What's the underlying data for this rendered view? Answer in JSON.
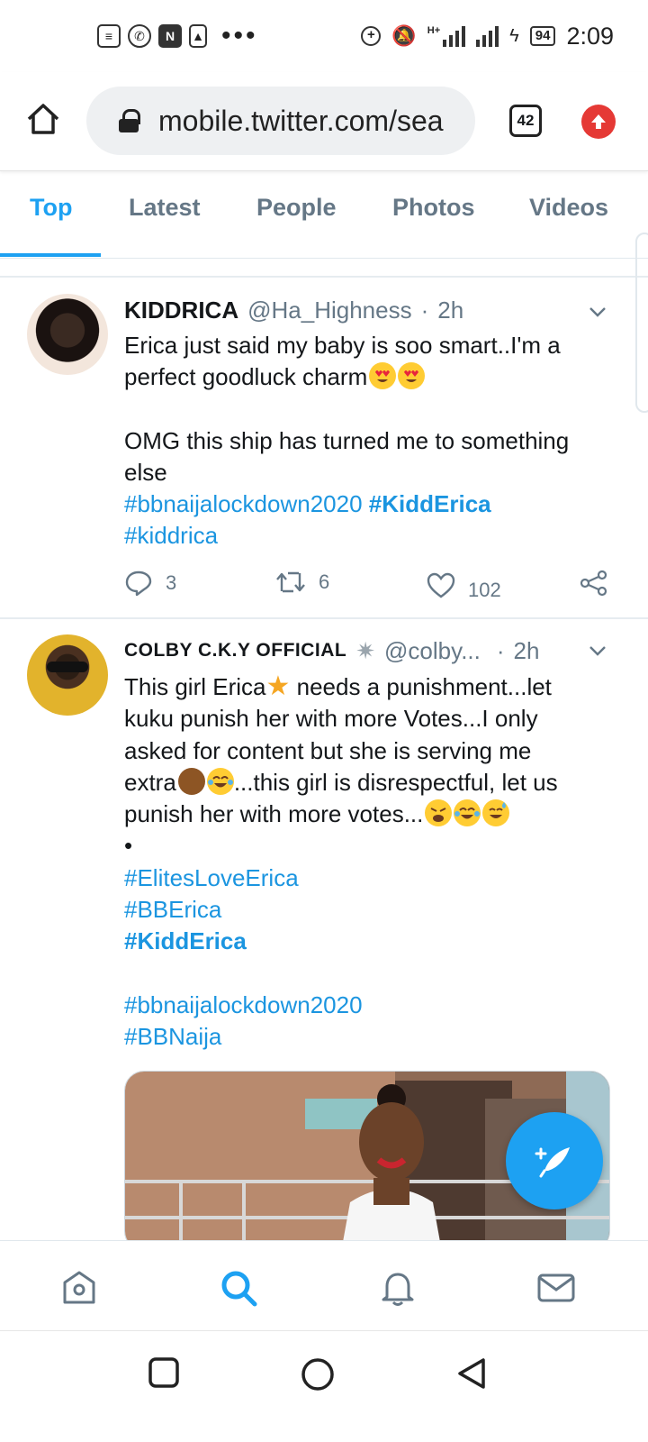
{
  "status_bar": {
    "left_icons": [
      "notes-icon",
      "whatsapp-icon",
      "n-app-icon",
      "alert-icon"
    ],
    "more": "•••",
    "battery": "94",
    "time": "2:09",
    "net_label": "H+"
  },
  "browser": {
    "url": "mobile.twitter.com/sea",
    "tab_count": "42"
  },
  "search_tabs": [
    {
      "label": "Top",
      "active": true
    },
    {
      "label": "Latest",
      "active": false
    },
    {
      "label": "People",
      "active": false
    },
    {
      "label": "Photos",
      "active": false
    },
    {
      "label": "Videos",
      "active": false
    }
  ],
  "tweets": [
    {
      "name": "KIDDRICA",
      "handle": "@Ha_Highness",
      "dot": "·",
      "time": "2h",
      "line1": "Erica just said my baby is soo smart..I'm a",
      "line2": "perfect goodluck charm",
      "line3": "OMG this ship has turned me to something",
      "line4": "else",
      "hashtag1": "#bbnaijalockdown2020",
      "hashtag2": "#KiddErica",
      "hashtag3": "#kiddrica",
      "replies": "3",
      "retweets": "6",
      "likes": "102"
    },
    {
      "name": "COLBY C.K.Y OFFICIAL",
      "handle": "@colby...",
      "dot": "·",
      "time": "2h",
      "line1": "This girl Erica",
      "line1b": " needs a punishment...let",
      "line2": "kuku punish her with more Votes...I only",
      "line3": "asked for content but she is serving me",
      "line4a": "extra",
      "line4b": "...this girl is disrespectful, let us",
      "line5": "punish her with more votes...",
      "bullet": "•",
      "hashtag1": "#ElitesLoveErica",
      "hashtag2": "#BBErica",
      "hashtag3": "#KiddErica",
      "hashtag4": "#bbnaijalockdown2020",
      "hashtag5": "#BBNaija"
    }
  ],
  "colors": {
    "accent": "#1da1f2",
    "hashtag": "#1b95e0",
    "muted": "#657786"
  },
  "bottom_nav": [
    "home-icon",
    "search-icon",
    "notifications-icon",
    "messages-icon"
  ],
  "system_nav": [
    "recents-icon",
    "home-circle-icon",
    "back-icon"
  ]
}
